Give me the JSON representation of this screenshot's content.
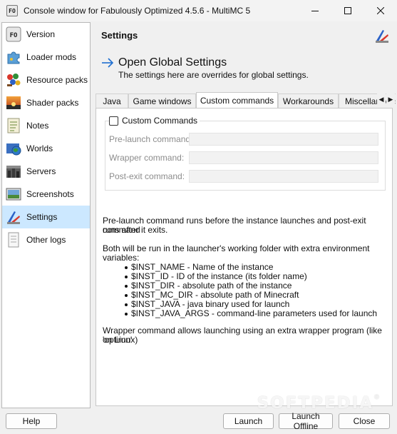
{
  "window": {
    "title": "Console window for Fabulously Optimized 4.5.6 - MultiMC 5",
    "app_icon_text": "FO"
  },
  "sidebar": {
    "items": [
      {
        "label": "Version",
        "icon": "fo-version-icon",
        "selected": false
      },
      {
        "label": "Loader mods",
        "icon": "puzzle-icon",
        "selected": false
      },
      {
        "label": "Resource packs",
        "icon": "paint-icon",
        "selected": false
      },
      {
        "label": "Shader packs",
        "icon": "shader-icon",
        "selected": false
      },
      {
        "label": "Notes",
        "icon": "notes-icon",
        "selected": false
      },
      {
        "label": "Worlds",
        "icon": "globe-icon",
        "selected": false
      },
      {
        "label": "Servers",
        "icon": "servers-icon",
        "selected": false
      },
      {
        "label": "Screenshots",
        "icon": "screenshot-icon",
        "selected": false
      },
      {
        "label": "Settings",
        "icon": "settings-icon",
        "selected": true
      },
      {
        "label": "Other logs",
        "icon": "logs-icon",
        "selected": false
      }
    ]
  },
  "main": {
    "header_title": "Settings",
    "global_settings_title": "Open Global Settings",
    "global_settings_subtitle": "The settings here are overrides for global settings.",
    "tabs": [
      {
        "label": "Java",
        "active": false
      },
      {
        "label": "Game windows",
        "active": false
      },
      {
        "label": "Custom commands",
        "active": true
      },
      {
        "label": "Workarounds",
        "active": false
      },
      {
        "label": "Miscellaneous",
        "active": false
      }
    ],
    "custom_commands": {
      "group_label": "Custom Commands",
      "checked": false,
      "pre_launch_label": "Pre-launch command:",
      "pre_launch_value": "",
      "wrapper_label": "Wrapper command:",
      "wrapper_value": "",
      "post_exit_label": "Post-exit command:",
      "post_exit_value": ""
    },
    "description_1a": "Pre-launch command runs before the instance launches and post-exit command",
    "description_1b": "runs after it exits.",
    "description_2": "Both will be run in the launcher's working folder with extra environment variables:",
    "env_vars": [
      "$INST_NAME - Name of the instance",
      "$INST_ID - ID of the instance (its folder name)",
      "$INST_DIR - absolute path of the instance",
      "$INST_MC_DIR - absolute path of Minecraft",
      "$INST_JAVA - java binary used for launch",
      "$INST_JAVA_ARGS - command-line parameters used for launch"
    ],
    "description_3a": "Wrapper command allows launching using an extra wrapper program (like 'optirun'",
    "description_3b": "on Linux)"
  },
  "buttons": {
    "help": "Help",
    "launch": "Launch",
    "launch_offline": "Launch Offline",
    "close": "Close"
  },
  "watermark": {
    "text": "SOFTPEDIA",
    "mark": "®"
  },
  "colors": {
    "selection": "#cce8ff",
    "link_arrow": "#1f6fd0"
  }
}
